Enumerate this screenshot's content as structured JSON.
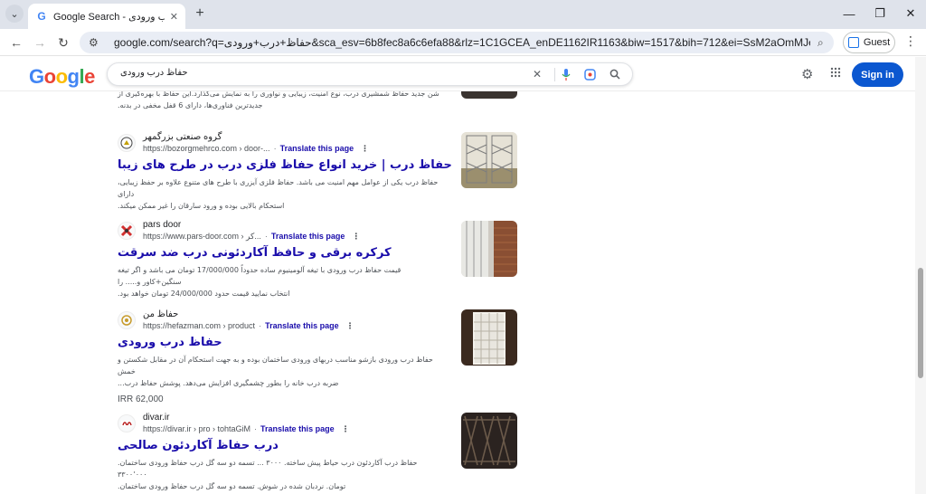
{
  "browser": {
    "tab_title": "Google Search - حفاظ درب ورودی",
    "tab_favicon": "G",
    "url": "google.com/search?q=حفاظ+درب+ورودی&sca_esv=6b8fec8a6c6efa88&rlz=1C1GCEA_enDE1162IR1163&biw=1517&bih=712&ei=SsM2aOmMJezFkdUPgefBwAk&ve...",
    "guest_label": "Guest"
  },
  "google": {
    "logo": [
      "G",
      "o",
      "o",
      "g",
      "l",
      "e"
    ],
    "query": "حفاظ درب ورودی",
    "signin_label": "Sign in"
  },
  "results": [
    {
      "snippet_lines": [
        "شن جدید حفاظ شمشیری درب، نوع امنیت، زیبایی و نوآوری را به نمایش می‌گذارد.این حفاظ با بهره‌گیری از",
        "جدیدترین فناوری‌ها، دارای 6 قفل مخفی در بدنه."
      ]
    },
    {
      "site": "گروه صنعتی بزرگمهر",
      "cite": "https://bozorgmehrco.com › door-...",
      "translate": "Translate this page",
      "title": "حفاظ درب | خرید انواع حفاظ فلزی درب در طرح های زیبا",
      "snippet_lines": [
        "حفاظ درب یکی از عوامل مهم امنیت می باشد. حفاظ فلزی آیزری با طرح های متنوع علاوه بر حفظ زیبایی، دارای",
        "استحکام بالایی بوده و ورود سارقان را غیر ممکن میکند."
      ]
    },
    {
      "site": "pars door",
      "cite": "https://www.pars-door.com › کر...",
      "translate": "Translate this page",
      "title": "کرکره برقی و حافظ آکاردئونی درب ضد سرقت",
      "snippet_lines": [
        "قیمت حفاظ درب ورودی با تیغه آلومینیوم ساده حدوداً 17/000/000 تومان می باشد و اگر تیغه سنگین+کاور و..... را",
        "انتخاب نمایید قیمت حدود 24/000/000 تومان خواهد بود."
      ]
    },
    {
      "site": "حفاظ من",
      "cite": "https://hefazman.com › product",
      "translate": "Translate this page",
      "title": "حفاظ درب ورودی",
      "snippet_lines": [
        "حفاظ درب ورودی بازشو مناسب دربهای ورودی ساختمان بوده و به جهت استحکام آن در مقابل شکستن و خمش",
        "ضربه درب خانه را بطور چشمگیری افزایش می‌دهد. پوشش حفاظ درب..."
      ],
      "price": "IRR 62,000"
    },
    {
      "site": "divar.ir",
      "cite": "https://divar.ir › pro › tohtaGiM",
      "translate": "Translate this page",
      "title": "درب حفاظ آکاردئون صالحی",
      "snippet_lines": [
        "حفاظ درب آکاردئون درب حیاط پیش ساخته. ۳۰۰۰ ... تسمه دو سه گل درب حفاظ ورودی ساختمان. ۳۳۰۰٬۰۰۰",
        "تومان. نردبان شده در شوش. تسمه دو سه گل درب حفاظ ورودی ساختمان."
      ]
    }
  ],
  "colors": {
    "link": "#1a0dab",
    "signin_bg": "#0b57d0",
    "tabstrip_bg": "#dfe3eb"
  }
}
